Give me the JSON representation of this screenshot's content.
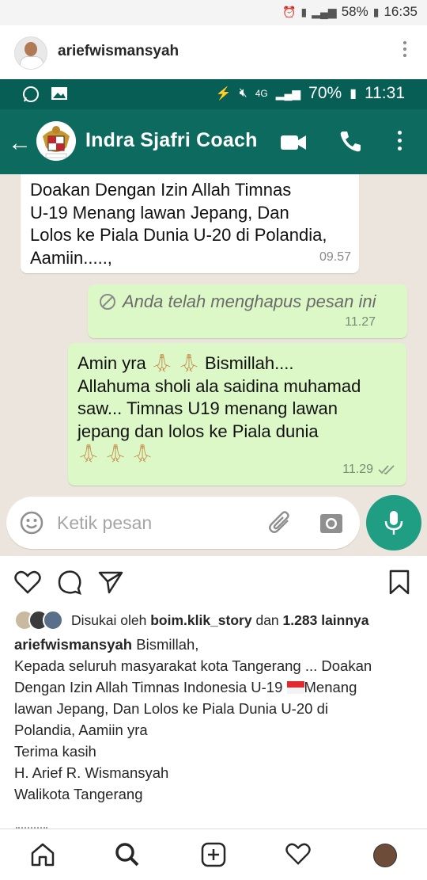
{
  "device_status": {
    "battery": "58%",
    "time": "16:35"
  },
  "ig_header": {
    "username": "ariefwismansyah"
  },
  "whatsapp": {
    "status": {
      "battery": "70%",
      "time": "11:31",
      "network": "4G"
    },
    "contact_name": "Indra Sjafri Coach",
    "messages": [
      {
        "lines": [
          "Doakan Dengan Izin Allah Timnas",
          "U-19 Menang lawan Jepang, Dan",
          "Lolos ke Piala Dunia U-20 di Polandia,",
          "Aamiin.....,"
        ],
        "time": "09.57"
      },
      {
        "text": "Anda telah menghapus pesan ini",
        "time": "11.27"
      },
      {
        "line1": "Amin yra",
        "line1b": "Bismillah....",
        "lines": [
          "Allahuma sholi ala saidina muhamad",
          "saw... Timnas U19 menang lawan",
          "jepang dan lolos ke Piala dunia"
        ],
        "time": "11.29"
      }
    ],
    "input_placeholder": "Ketik pesan"
  },
  "likes": {
    "prefix": "Disukai oleh",
    "user": "boim.klik_story",
    "middle": "dan",
    "count": "1.283 lainnya"
  },
  "caption": {
    "username": "ariefwismansyah",
    "first": "Bismillah,",
    "line2": "Kepada seluruh masyarakat kota Tangerang ... Doakan",
    "line3a": "Dengan Izin Allah Timnas Indonesia  U-19",
    "line3b": "Menang",
    "line4": "lawan Jepang, Dan Lolos ke Piala Dunia U-20 di",
    "line5": "Polandia, Aamiin yra",
    "line6": "Terima kasih",
    "line7": "H. Arief R. Wismansyah",
    "line8": "Walikota Tangerang"
  },
  "colors": {
    "wa_green": "#075e54",
    "bubble_out": "#dcf8c6",
    "fab": "#1f9e84"
  }
}
